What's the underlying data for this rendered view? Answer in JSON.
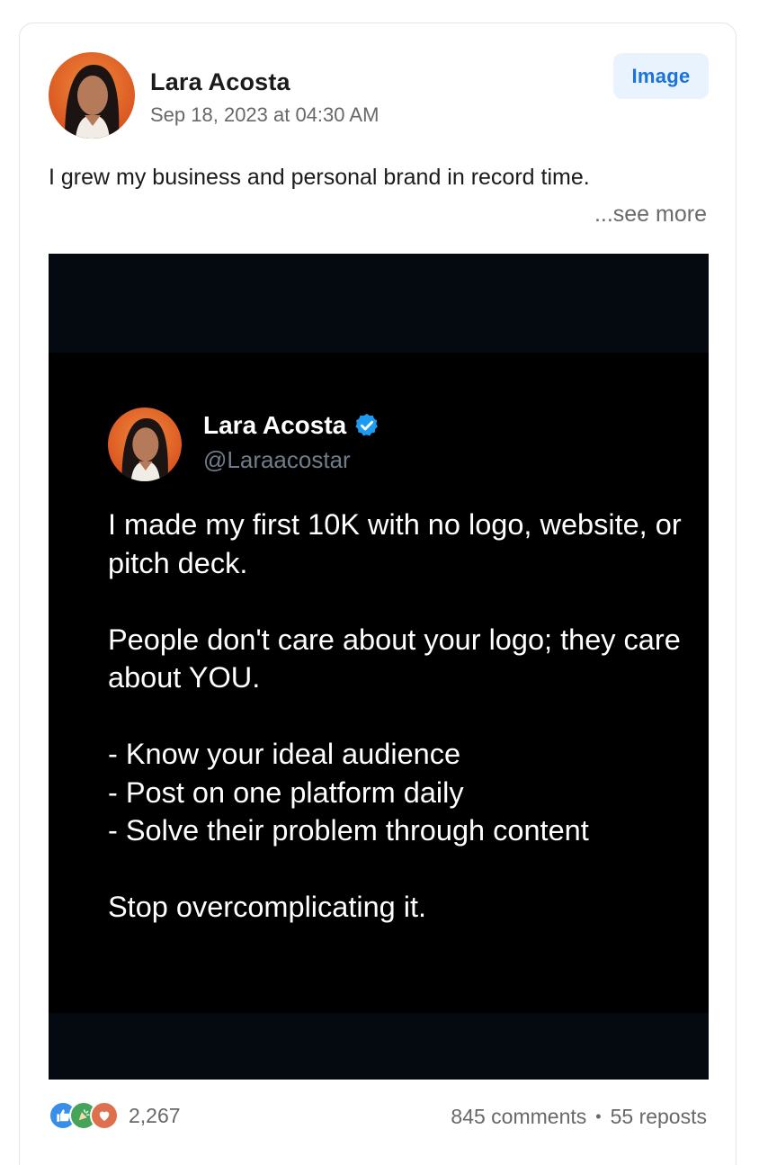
{
  "post": {
    "author_name": "Lara Acosta",
    "date": "Sep 18, 2023 at 04:30 AM",
    "type_badge": "Image",
    "text": "I grew my business and personal brand in record time.",
    "see_more": "...see more"
  },
  "media": {
    "tweet": {
      "name": "Lara Acosta",
      "handle": "@Laraacostar",
      "verified": true,
      "paragraphs": [
        "I made my first 10K with no logo, website, or pitch deck.",
        "People don't care about your logo; they care about YOU.",
        "- Know your ideal audience\n- Post on one platform daily\n- Solve their problem through content",
        "Stop overcomplicating it."
      ]
    }
  },
  "footer": {
    "reaction_count": "2,267",
    "comments": "845 comments",
    "separator": "•",
    "reposts": "55 reposts",
    "reaction_icons": [
      "like-icon",
      "celebrate-icon",
      "love-icon"
    ]
  },
  "colors": {
    "badge_bg": "#e8f3fd",
    "badge_text": "#1a73d9",
    "verified": "#1d9bf0",
    "avatar_bg": "#e8692e"
  }
}
